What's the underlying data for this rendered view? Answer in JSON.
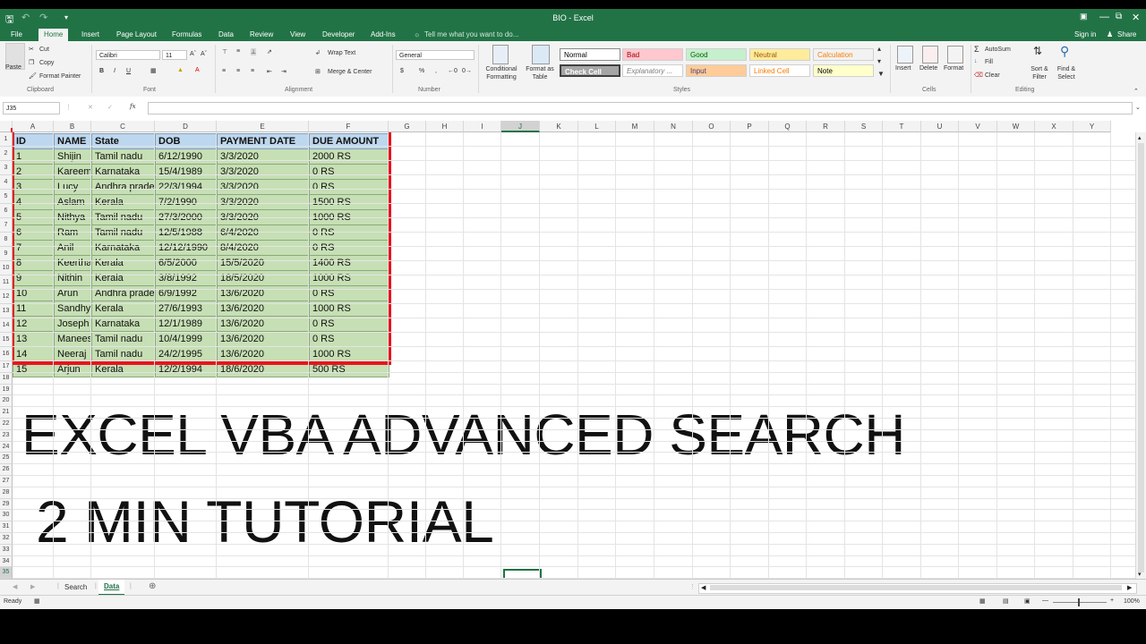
{
  "window": {
    "title": "BIO - Excel"
  },
  "tabs": [
    "File",
    "Home",
    "Insert",
    "Page Layout",
    "Formulas",
    "Data",
    "Review",
    "View",
    "Developer",
    "Add-Ins"
  ],
  "active_tab": "Home",
  "tell_me": "Tell me what you want to do...",
  "signin": "Sign in",
  "share": "Share",
  "ribbon": {
    "clipboard": {
      "paste": "Paste",
      "cut": "Cut",
      "copy": "Copy",
      "format_painter": "Format Painter",
      "label": "Clipboard"
    },
    "font": {
      "name": "Calibri",
      "size": "11",
      "label": "Font",
      "bold": "B",
      "italic": "I",
      "underline": "U"
    },
    "alignment": {
      "wrap": "Wrap Text",
      "merge": "Merge & Center",
      "label": "Alignment"
    },
    "number": {
      "format": "General",
      "label": "Number",
      "currency": "$",
      "percent": "%"
    },
    "styles_btns": {
      "conditional": "Conditional Formatting",
      "format_table": "Format as Table",
      "label": "Styles"
    },
    "styles": [
      {
        "name": "Normal",
        "bg": "#ffffff",
        "fg": "#000000"
      },
      {
        "name": "Bad",
        "bg": "#ffc7ce",
        "fg": "#9c0006"
      },
      {
        "name": "Good",
        "bg": "#c6efce",
        "fg": "#006100"
      },
      {
        "name": "Neutral",
        "bg": "#ffeb9c",
        "fg": "#9c5700"
      },
      {
        "name": "Calculation",
        "bg": "#f2f2f2",
        "fg": "#fa7d00"
      },
      {
        "name": "Check Cell",
        "bg": "#a5a5a5",
        "fg": "#ffffff"
      },
      {
        "name": "Explanatory ...",
        "bg": "#ffffff",
        "fg": "#7f7f7f"
      },
      {
        "name": "Input",
        "bg": "#ffcc99",
        "fg": "#3f3f76"
      },
      {
        "name": "Linked Cell",
        "bg": "#ffffff",
        "fg": "#fa7d00"
      },
      {
        "name": "Note",
        "bg": "#ffffcc",
        "fg": "#000000"
      }
    ],
    "cells": {
      "insert": "Insert",
      "delete": "Delete",
      "format": "Format",
      "label": "Cells"
    },
    "editing": {
      "autosum": "AutoSum",
      "fill": "Fill",
      "clear": "Clear",
      "sort": "Sort & Filter",
      "find": "Find & Select",
      "label": "Editing"
    }
  },
  "formula_bar": {
    "name_box": "J35",
    "fx": "fx",
    "content": ""
  },
  "columns": [
    "A",
    "B",
    "C",
    "D",
    "E",
    "F",
    "G",
    "H",
    "I",
    "J",
    "K",
    "L",
    "M",
    "N",
    "O",
    "P",
    "Q",
    "R",
    "S",
    "T",
    "U",
    "V",
    "W",
    "X",
    "Y"
  ],
  "table": {
    "headers": [
      "ID",
      "NAME",
      "State",
      "DOB",
      "PAYMENT DATE",
      "DUE AMOUNT"
    ],
    "rows": [
      [
        "1",
        "Shijin",
        "Tamil nadu",
        "6/12/1990",
        "3/3/2020",
        "2000 RS"
      ],
      [
        "2",
        "Kareem",
        "Karnataka",
        "15/4/1989",
        "3/3/2020",
        "0 RS"
      ],
      [
        "3",
        "Lucy",
        "Andhra prade",
        "22/3/1994",
        "3/3/2020",
        "0 RS"
      ],
      [
        "4",
        "Aslam",
        "Kerala",
        "7/2/1990",
        "3/3/2020",
        "1500 RS"
      ],
      [
        "5",
        "Nithya",
        "Tamil nadu",
        "27/3/2000",
        "3/3/2020",
        "1000 RS"
      ],
      [
        "6",
        "Ram",
        "Tamil nadu",
        "12/5/1988",
        "6/4/2020",
        "0 RS"
      ],
      [
        "7",
        "Anil",
        "Karnataka",
        "12/12/1990",
        "8/4/2020",
        "0 RS"
      ],
      [
        "8",
        "Keertha",
        "Kerala",
        "6/5/2000",
        "15/5/2020",
        "1400 RS"
      ],
      [
        "9",
        "Nithin",
        "Kerala",
        "3/8/1992",
        "18/5/2020",
        "1000 RS"
      ],
      [
        "10",
        "Arun",
        "Andhra prade",
        "6/9/1992",
        "13/6/2020",
        "0 RS"
      ],
      [
        "11",
        "Sandhya",
        "Kerala",
        "27/6/1993",
        "13/6/2020",
        "1000 RS"
      ],
      [
        "12",
        "Joseph",
        "Karnataka",
        "12/1/1989",
        "13/6/2020",
        "0 RS"
      ],
      [
        "13",
        "Manees",
        "Tamil nadu",
        "10/4/1999",
        "13/6/2020",
        "0 RS"
      ],
      [
        "14",
        "Neeraj",
        "Tamil nadu",
        "24/2/1995",
        "13/6/2020",
        "1000 RS"
      ],
      [
        "15",
        "Arjun",
        "Kerala",
        "12/2/1994",
        "18/6/2020",
        "500 RS"
      ]
    ]
  },
  "overlay": {
    "line1": "EXCEL VBA ADVANCED SEARCH",
    "line2": "2 MIN TUTORIAL"
  },
  "sheets": [
    "Search",
    "Data"
  ],
  "active_sheet": "Data",
  "status": {
    "ready": "Ready",
    "zoom": "100%"
  }
}
